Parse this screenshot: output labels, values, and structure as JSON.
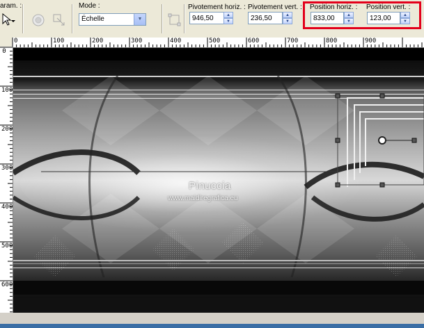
{
  "toolbar": {
    "presets_label": "aram. :",
    "mode_label": "Mode :",
    "mode_value": "Échelle",
    "rot_h_label": "Pivotement horiz. :",
    "rot_h_value": "946,50",
    "rot_v_label": "Pivotement vert. :",
    "rot_v_value": "236,50",
    "pos_h_label": "Position horiz. :",
    "pos_h_value": "833,00",
    "pos_v_label": "Position vert. :",
    "pos_v_value": "123,00",
    "highlight_color": "#e3001b"
  },
  "ruler": {
    "h_labels": [
      "0",
      "100",
      "200",
      "300",
      "400",
      "500",
      "600",
      "700",
      "800",
      "900"
    ],
    "v_labels": [
      "0",
      "100",
      "200",
      "300",
      "400",
      "500",
      "600"
    ]
  },
  "canvas": {
    "watermark_title": "Pinuccia",
    "watermark_url": "www.maidiregrafica.eu"
  },
  "icons": [
    "pointer-arrow-icon",
    "dropdown-arrow-icon",
    "circle-disabled-icon",
    "transform-disabled-icon",
    "spin-up-icon",
    "spin-down-icon",
    "handle-icon"
  ]
}
